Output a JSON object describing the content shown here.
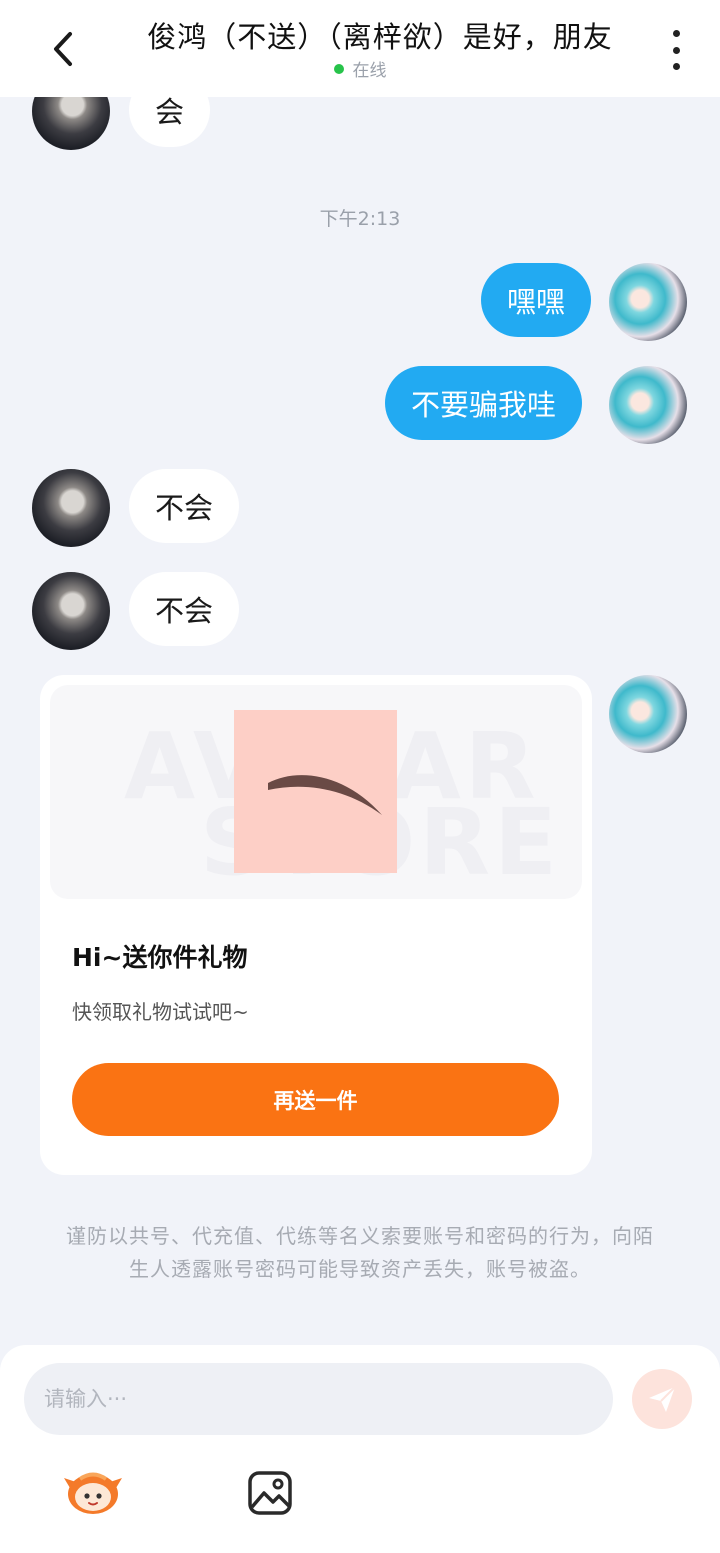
{
  "header": {
    "title": "俊鸿（不送）（离梓欲）是好，朋友",
    "status": "在线",
    "back_icon": "chevron-left-icon",
    "more_icon": "more-vertical-icon"
  },
  "messages": [
    {
      "side": "in",
      "text": "会"
    },
    {
      "type": "time",
      "text": "下午2:13"
    },
    {
      "side": "out",
      "text": "嘿嘿"
    },
    {
      "side": "out",
      "text": "不要骗我哇"
    },
    {
      "side": "in",
      "text": "不会"
    },
    {
      "side": "in",
      "text": "不会"
    }
  ],
  "gift_card": {
    "title": "Hi~送你件礼物",
    "subtitle": "快领取礼物试试吧~",
    "button_label": "再送一件"
  },
  "notice": "谨防以共号、代充值、代练等名义索要账号和密码的行为，向陌生人透露账号密码可能导致资产丢失，账号被盗。",
  "input": {
    "placeholder": "请输入···",
    "value": ""
  },
  "toolbar": {
    "send_icon": "send-icon",
    "emoji_icon": "emoji-mascot-icon",
    "image_icon": "image-icon"
  },
  "colors": {
    "accent_blue": "#22aaf2",
    "accent_orange": "#fa7313",
    "online_green": "#27c34a",
    "background": "#f1f3f9"
  }
}
